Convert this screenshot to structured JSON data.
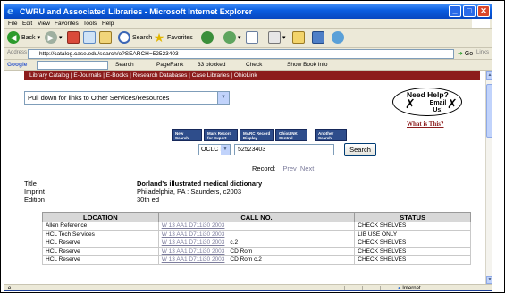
{
  "window": {
    "title": "CWRU and Associated Libraries - Microsoft Internet Explorer",
    "buttons": {
      "minimize": "_",
      "maximize": "□",
      "close": "✕"
    }
  },
  "menu": [
    "File",
    "Edit",
    "View",
    "Favorites",
    "Tools",
    "Help"
  ],
  "toolbar": {
    "back": "Back",
    "search": "Search",
    "favorites": "Favorites"
  },
  "address": {
    "label": "Address",
    "url": "http://catalog.case.edu/search/o?SEARCH=52523403",
    "go": "Go",
    "links": "Links"
  },
  "google_bar": {
    "logo": "Google",
    "search": "Search",
    "pagerank": "PageRank",
    "blocked": "33 blocked",
    "check": "Check",
    "showbook": "Show Book Info"
  },
  "page": {
    "nav_links": [
      "Library Catalog",
      "E-Journals",
      "E-Books",
      "Research Databases",
      "Case Libraries",
      "OhioLink"
    ],
    "nav_separator": " | ",
    "services_dropdown": "Pull down for links to Other Services/Resources",
    "help": {
      "need_help": "Need Help?",
      "email": "Email Us!",
      "what_is_this": "What is This?"
    },
    "search_buttons": [
      {
        "line1": "New",
        "line2": "Search"
      },
      {
        "line1": "Mark Record",
        "line2": "for Export"
      },
      {
        "line1": "MARC Record",
        "line2": "Display"
      },
      {
        "line1": "OhioLINK",
        "line2": "Central"
      },
      {
        "line1": "Another",
        "line2": "Search"
      }
    ],
    "search_type": "OCLC NO",
    "search_value": "52523403",
    "search_button": "Search",
    "record_label": "Record:",
    "record_prev": "Prev",
    "record_next": "Next",
    "bib": [
      {
        "key": "Title",
        "value": "Dorland's illustrated medical dictionary",
        "bold": true
      },
      {
        "key": "Imprint",
        "value": "Philadelphia, PA : Saunders, c2003",
        "bold": false
      },
      {
        "key": "Edition",
        "value": "30th ed",
        "bold": false
      }
    ],
    "holdings": {
      "headers": [
        "LOCATION",
        "CALL NO.",
        "STATUS"
      ],
      "rows": [
        {
          "location": "Allen Reference",
          "call": "W 13 AA1 D711i30 2003",
          "extra": "",
          "status": "CHECK SHELVES"
        },
        {
          "location": "HCL Tech Services",
          "call": "W 13 AA1 D711i30 2003",
          "extra": "",
          "status": "LIB USE ONLY"
        },
        {
          "location": "HCL Reserve",
          "call": "W 13 AA1 D711i30 2003",
          "extra": "c.2",
          "status": "CHECK SHELVES"
        },
        {
          "location": "HCL Reserve",
          "call": "W 13 AA1 D711i30 2003",
          "extra": "CD Rom",
          "status": "CHECK SHELVES"
        },
        {
          "location": "HCL Reserve",
          "call": "W 13 AA1 D711i30 2003",
          "extra": "CD Rom  c.2",
          "status": "CHECK SHELVES"
        }
      ]
    }
  },
  "status": {
    "zone": "Internet"
  },
  "colors": {
    "nav_bg": "#8c1c1c",
    "search_btn_bg": "#2e4d8b",
    "link": "#7c7c9c"
  }
}
